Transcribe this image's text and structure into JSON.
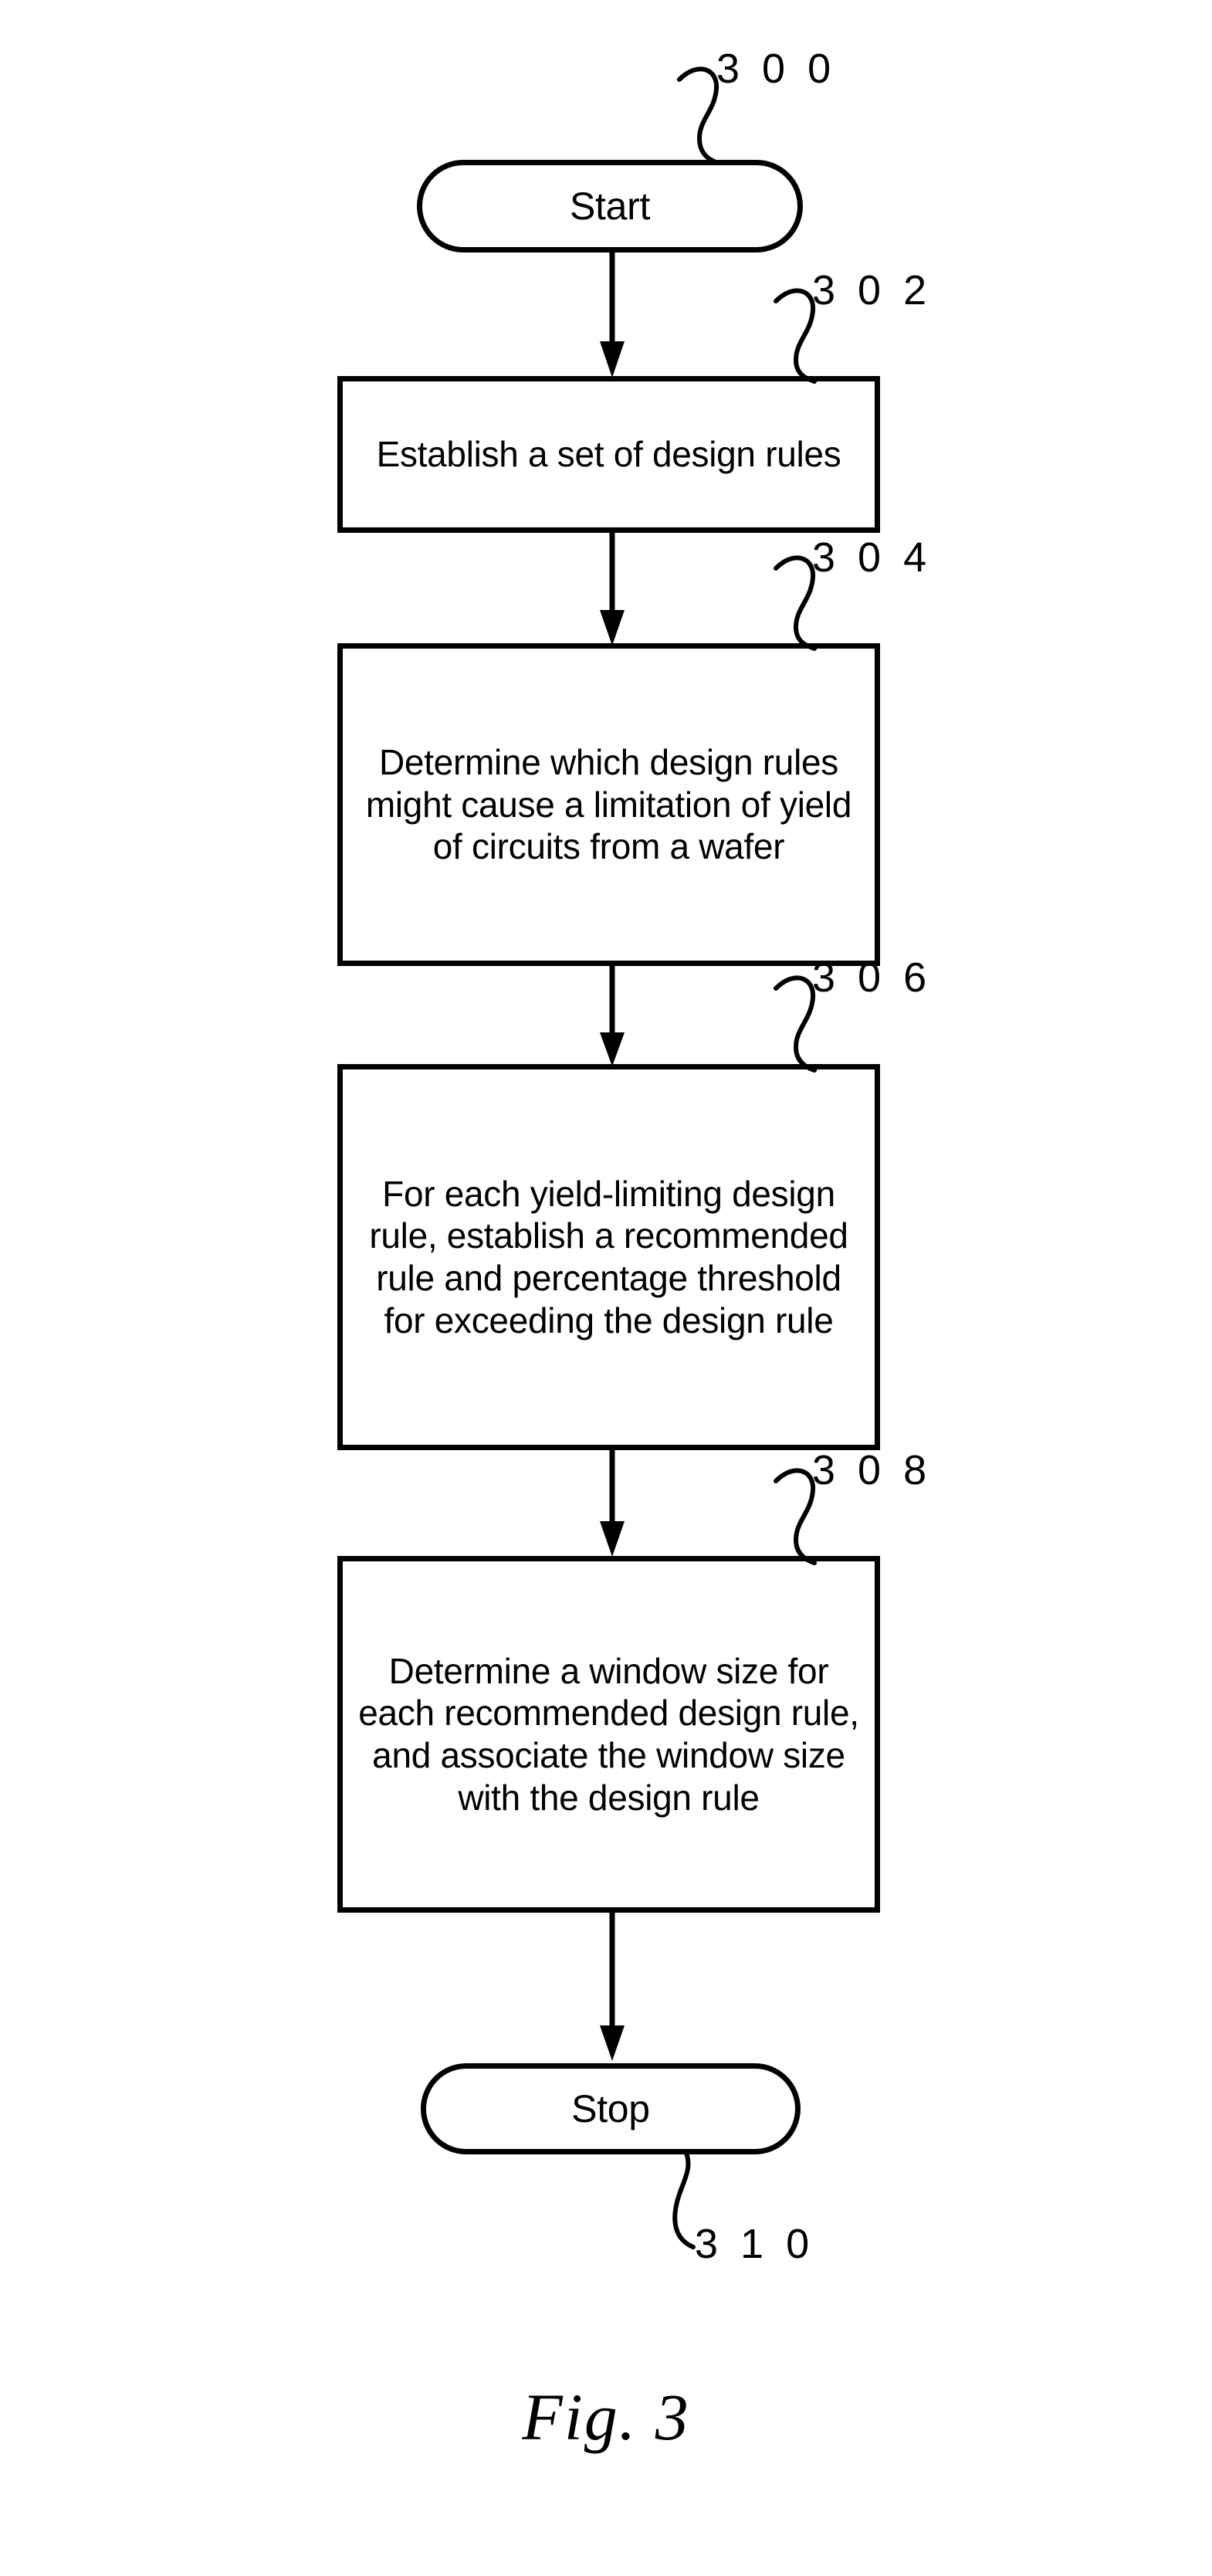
{
  "figure": {
    "caption": "Fig.  3",
    "number": "3",
    "background_color": "#ffffff",
    "line_color": "#000000"
  },
  "flowchart": {
    "nodes": [
      {
        "id": "start",
        "shape": "terminator",
        "label": "Start",
        "ref": "3 0 0"
      },
      {
        "id": "step-302",
        "shape": "process",
        "label": "Establish a set of design rules",
        "ref": "3 0 2"
      },
      {
        "id": "step-304",
        "shape": "process",
        "label": "Determine which design rules might cause a limitation of yield of circuits from a wafer",
        "ref": "3 0 4"
      },
      {
        "id": "step-306",
        "shape": "process",
        "label": "For each yield-limiting design rule, establish a recommended rule and percentage threshold for exceeding the design rule",
        "ref": "3 0 6"
      },
      {
        "id": "step-308",
        "shape": "process",
        "label": "Determine a window size for each recommended design rule, and associate the window size with the design rule",
        "ref": "3 0 8"
      },
      {
        "id": "stop",
        "shape": "terminator",
        "label": "Stop",
        "ref": "3 1 0"
      }
    ],
    "connectors": [
      {
        "from": "start",
        "to": "step-302"
      },
      {
        "from": "step-302",
        "to": "step-304"
      },
      {
        "from": "step-304",
        "to": "step-306"
      },
      {
        "from": "step-306",
        "to": "step-308"
      },
      {
        "from": "step-308",
        "to": "stop"
      }
    ]
  }
}
